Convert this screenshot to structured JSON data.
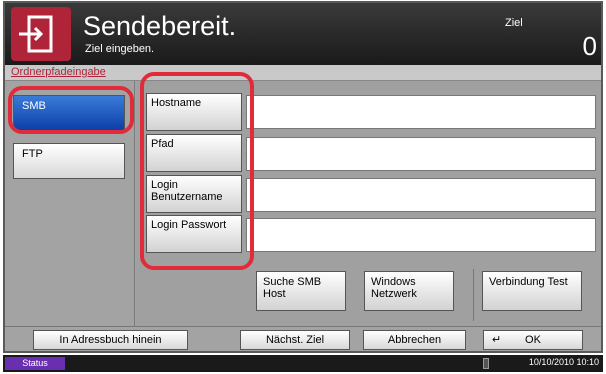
{
  "header": {
    "title": "Sendebereit.",
    "subtitle": "Ziel eingeben.",
    "target_label": "Ziel",
    "target_count": "0"
  },
  "section": {
    "tab_label": "Ordnerpfadeingabe"
  },
  "protocols": [
    {
      "label": "SMB",
      "selected": true
    },
    {
      "label": "FTP",
      "selected": false
    }
  ],
  "fields": [
    {
      "label": "Hostname"
    },
    {
      "label": "Pfad"
    },
    {
      "label": "Login Benutzername"
    },
    {
      "label": "Login Passwort"
    }
  ],
  "actions": {
    "search": "Suche SMB Host",
    "network": "Windows Netzwerk",
    "test": "Verbindung Test"
  },
  "bottom": {
    "addressbook": "In Adressbuch hinein",
    "next": "Nächst. Ziel",
    "cancel": "Abbrechen",
    "ok": "OK"
  },
  "statusbar": {
    "status": "Status",
    "datetime": "10/10/2010  10:10"
  },
  "colors": {
    "accent": "#b0243a",
    "selected": "#0d3fa8",
    "highlight_ring": "#e02c3a"
  }
}
